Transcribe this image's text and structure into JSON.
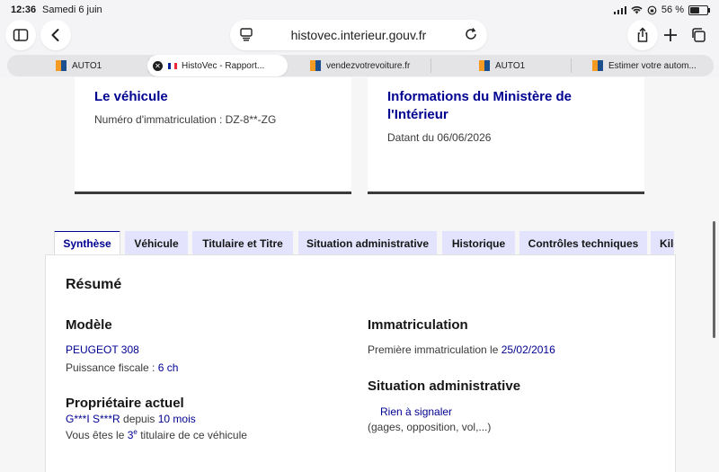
{
  "status": {
    "time": "12:36",
    "date": "Samedi 6 juin",
    "battery": "56 %"
  },
  "browser": {
    "url": "histovec.interieur.gouv.fr",
    "tabs": [
      {
        "label": "AUTO1",
        "favicon": "auto1-favicon"
      },
      {
        "label": "HistoVec - Rapport...",
        "favicon": "fr-flag-favicon",
        "active": true
      },
      {
        "label": "vendezvotrevoiture.fr",
        "favicon": "auto1-favicon"
      },
      {
        "label": "AUTO1",
        "favicon": "auto1-favicon"
      },
      {
        "label": "Estimer votre autom...",
        "favicon": "auto1-favicon"
      }
    ]
  },
  "cards": {
    "vehicle": {
      "title": "Le véhicule",
      "registration": "Numéro d'immatriculation : DZ-8**-ZG"
    },
    "ministry": {
      "title_line1": "Informations du Ministère de",
      "title_line2": "l'Intérieur",
      "date": "Datant du 06/06/2026"
    }
  },
  "tabs": [
    {
      "label": "Synthèse",
      "active": true
    },
    {
      "label": "Véhicule"
    },
    {
      "label": "Titulaire et Titre"
    },
    {
      "label": "Situation administrative"
    },
    {
      "label": "Historique"
    },
    {
      "label": "Contrôles techniques"
    },
    {
      "label": "Kilo"
    }
  ],
  "summary": {
    "heading": "Résumé",
    "model": {
      "title": "Modèle",
      "name": "PEUGEOT 308",
      "power_label": "Puissance fiscale : ",
      "power_value": "6 ch"
    },
    "owner": {
      "title": "Propriétaire actuel",
      "name": "G***I S***R",
      "since_label": " depuis ",
      "since_value": "10 mois",
      "rank_prefix": "Vous êtes le ",
      "rank_value": "3",
      "rank_sup": "e",
      "rank_suffix": " titulaire de ce véhicule"
    },
    "registration": {
      "title": "Immatriculation",
      "label": "Première immatriculation le ",
      "date": "25/02/2016"
    },
    "admin": {
      "title": "Situation administrative",
      "status": "Rien à signaler",
      "details": "(gages, opposition, vol,...)"
    }
  },
  "colors": {
    "accent": "#000091",
    "tab_bg": "#e3e3fd"
  }
}
